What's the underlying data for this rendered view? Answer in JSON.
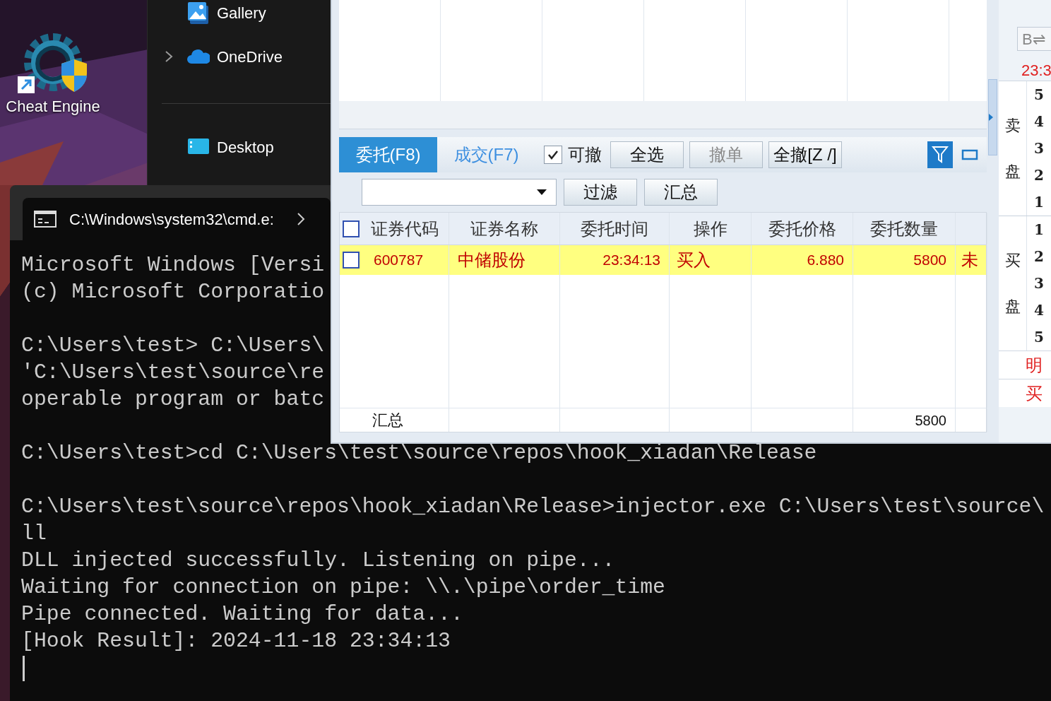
{
  "desktop": {
    "shortcuts": [
      {
        "label": "Cheat Engine"
      }
    ]
  },
  "explorer": {
    "nav_items": [
      {
        "label": "Gallery",
        "kind": "gallery",
        "expandable": false
      },
      {
        "label": "OneDrive",
        "kind": "cloud",
        "expandable": true
      },
      {
        "label": "Desktop",
        "kind": "desktop",
        "expandable": false
      }
    ]
  },
  "terminal": {
    "title": "C:\\Windows\\system32\\cmd.e:",
    "blocks": [
      [
        "Microsoft Windows [Versi",
        "(c) Microsoft Corporatio"
      ],
      [
        "C:\\Users\\test> C:\\Users\\",
        "'C:\\Users\\test\\source\\re",
        "operable program or batc"
      ],
      [
        "C:\\Users\\test>cd C:\\Users\\test\\source\\repos\\hook_xiadan\\Release"
      ],
      [
        "C:\\Users\\test\\source\\repos\\hook_xiadan\\Release>injector.exe C:\\Users\\test\\source\\",
        "ll",
        "DLL injected successfully. Listening on pipe...",
        "Waiting for connection on pipe: \\\\.\\pipe\\order_time",
        "Pipe connected. Waiting for data...",
        "[Hook Result]: 2024-11-18 23:34:13"
      ]
    ]
  },
  "trading": {
    "tabs": [
      {
        "label": "委托(F8)",
        "selected": true
      },
      {
        "label": "成交(F7)",
        "selected": false
      }
    ],
    "option": {
      "label": "可撤",
      "checked": true
    },
    "buttons": [
      {
        "label": "全选",
        "disabled": false
      },
      {
        "label": "撤单",
        "disabled": true
      },
      {
        "label": "全撤[Z /]",
        "disabled": false
      }
    ],
    "filter_buttons": [
      "过滤",
      "汇总"
    ],
    "table": {
      "header_checked": false,
      "columns": [
        "证券代码",
        "证券名称",
        "委托时间",
        "操作",
        "委托价格",
        "委托数量"
      ],
      "rows": [
        {
          "checked": false,
          "selected": true,
          "cells": [
            "600787",
            "中储股份",
            "23:34:13",
            "买入",
            "6.880",
            "5800",
            "未"
          ]
        }
      ],
      "summary": {
        "label": "汇总",
        "quantity": "5800"
      }
    }
  },
  "quote_panel": {
    "switch_button": "B⇌",
    "time": "23:3",
    "sections": [
      {
        "label": [
          "卖",
          "盘"
        ],
        "levels": [
          "5",
          "4",
          "3",
          "2",
          "1"
        ]
      },
      {
        "label": [
          "买",
          "盘"
        ],
        "levels": [
          "1",
          "2",
          "3",
          "4",
          "5"
        ]
      }
    ],
    "links": [
      "明",
      "买"
    ]
  }
}
